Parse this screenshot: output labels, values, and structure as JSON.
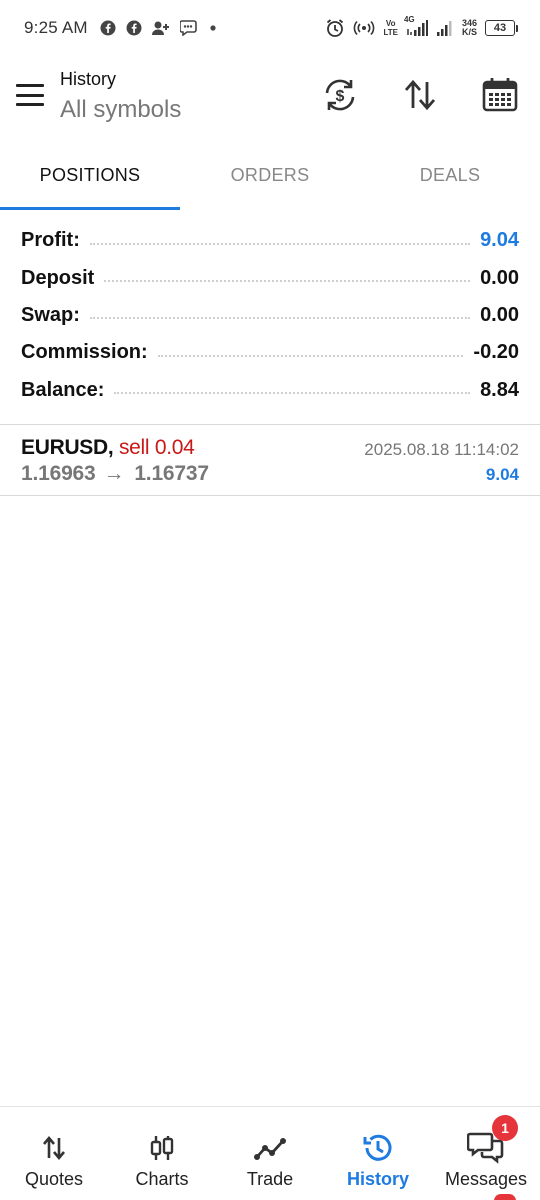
{
  "status_bar": {
    "time": "9:25 AM",
    "volte_top": "Vo",
    "volte_bottom": "LTE",
    "network_gen": "4G",
    "speed_value": "346",
    "speed_unit": "K/S",
    "battery": "43"
  },
  "header": {
    "title": "History",
    "subtitle": "All symbols"
  },
  "tabs": [
    {
      "label": "POSITIONS",
      "active": true
    },
    {
      "label": "ORDERS",
      "active": false
    },
    {
      "label": "DEALS",
      "active": false
    }
  ],
  "summary": {
    "profit_label": "Profit:",
    "profit_value": "9.04",
    "deposit_label": "Deposit",
    "deposit_value": "0.00",
    "swap_label": "Swap:",
    "swap_value": "0.00",
    "commission_label": "Commission:",
    "commission_value": "-0.20",
    "balance_label": "Balance:",
    "balance_value": "8.84"
  },
  "position": {
    "symbol": "EURUSD,",
    "type": "sell 0.04",
    "open_price": "1.16963",
    "arrow": "→",
    "close_price": "1.16737",
    "time": "2025.08.18 11:14:02",
    "profit": "9.04"
  },
  "bottom_nav": {
    "quotes": "Quotes",
    "charts": "Charts",
    "trade": "Trade",
    "history": "History",
    "messages": "Messages",
    "messages_badge": "1"
  },
  "colors": {
    "accent": "#1e7be0",
    "sell": "#c91818",
    "badge": "#e5343a"
  }
}
